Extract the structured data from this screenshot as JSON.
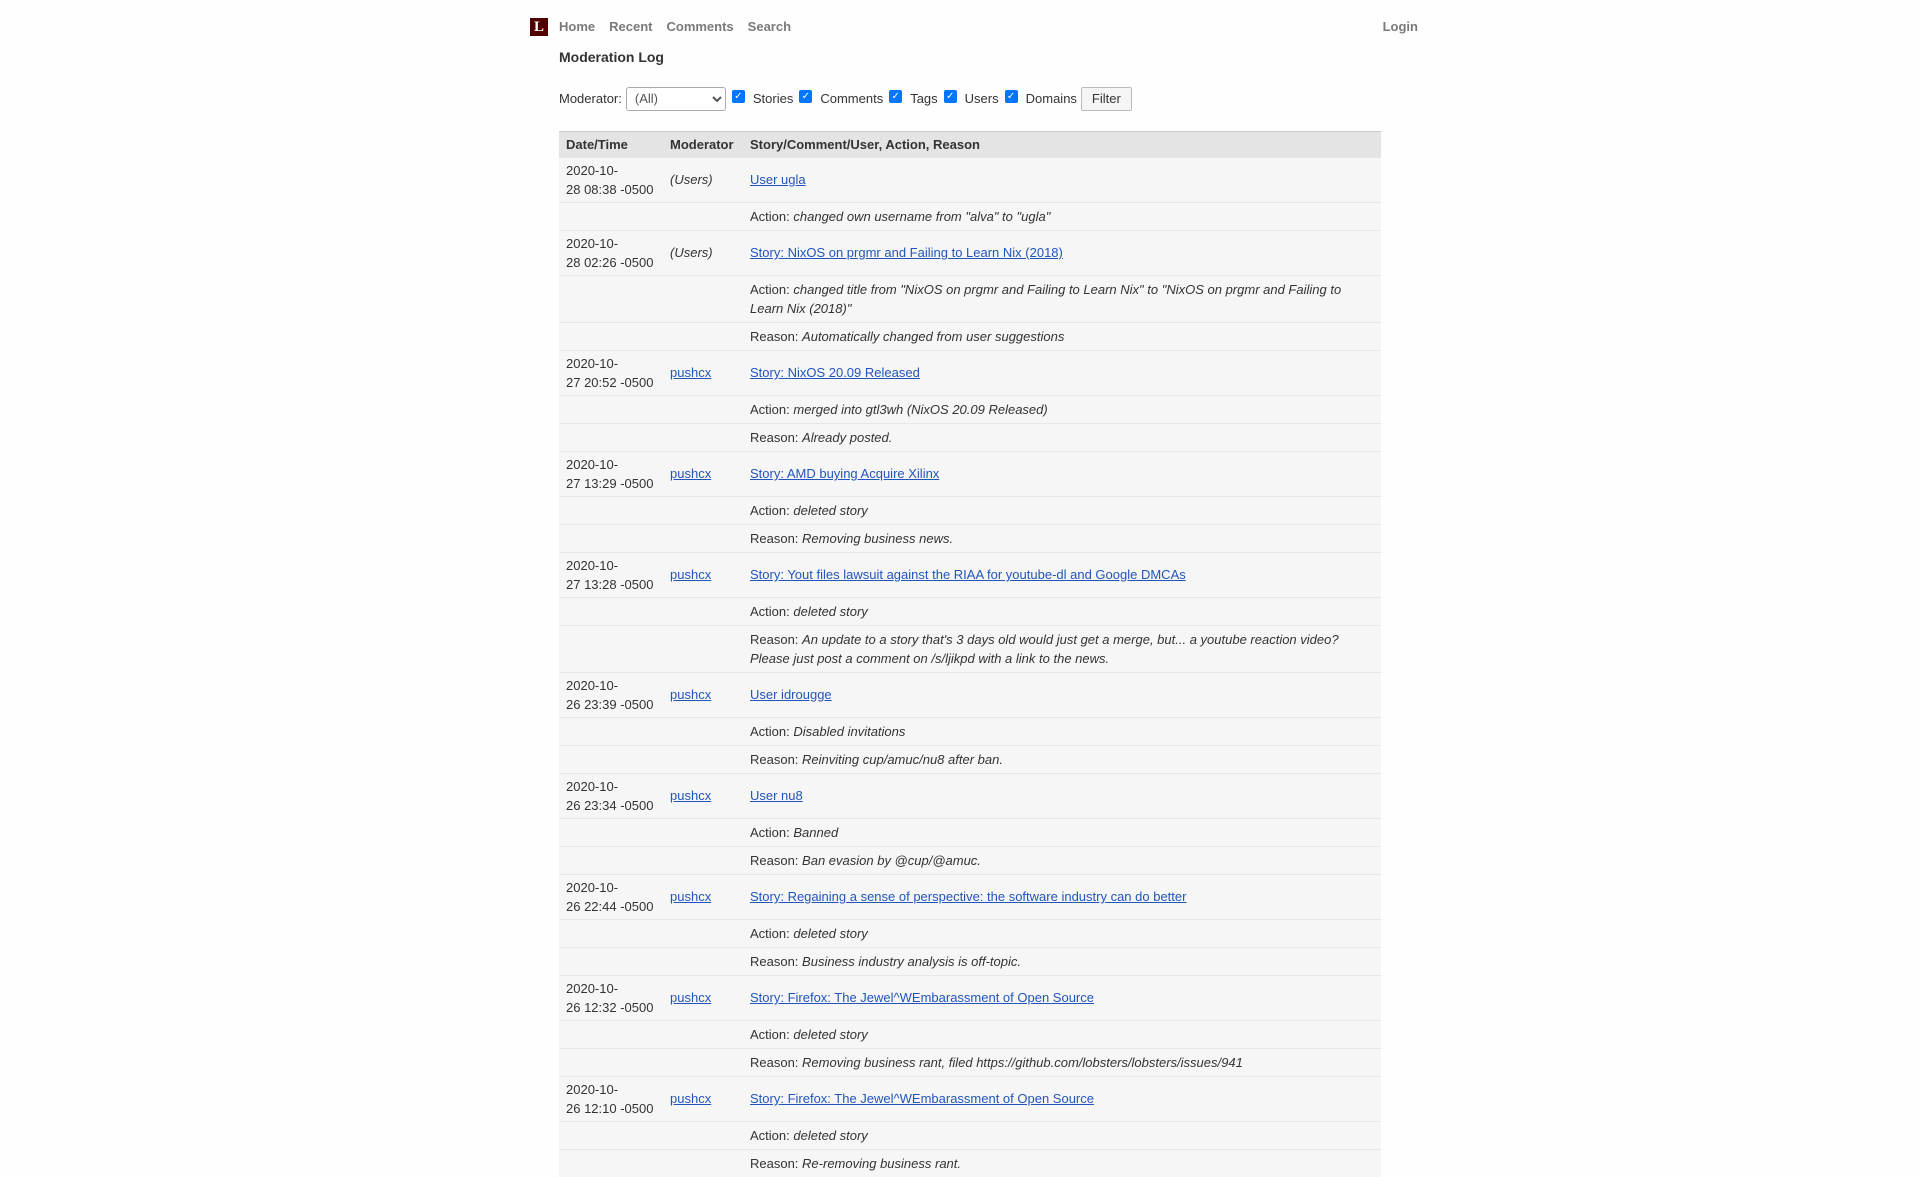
{
  "header": {
    "logo": "L",
    "nav": [
      "Home",
      "Recent",
      "Comments",
      "Search"
    ],
    "login": "Login"
  },
  "page_title": "Moderation Log",
  "filter": {
    "moderator_label": "Moderator:",
    "moderator_selected": "(All)",
    "checkboxes": [
      "Stories",
      "Comments",
      "Tags",
      "Users",
      "Domains"
    ],
    "button": "Filter"
  },
  "table": {
    "headers": [
      "Date/Time",
      "Moderator",
      "Story/Comment/User, Action, Reason"
    ],
    "action_prefix": "Action:",
    "reason_prefix": "Reason:",
    "entries": [
      {
        "date_line1": "2020-10-",
        "date_line2": "28 08:38 -0500",
        "moderator": "(Users)",
        "mod_is_link": false,
        "subject": "User ugla",
        "action": "changed own username from \"alva\" to \"ugla\"",
        "reason": null
      },
      {
        "date_line1": "2020-10-",
        "date_line2": "28 02:26 -0500",
        "moderator": "(Users)",
        "mod_is_link": false,
        "subject": "Story: NixOS on prgmr and Failing to Learn Nix (2018)",
        "action": "changed title from \"NixOS on prgmr and Failing to Learn Nix\" to \"NixOS on prgmr and Failing to Learn Nix (2018)\"",
        "reason": "Automatically changed from user suggestions"
      },
      {
        "date_line1": "2020-10-",
        "date_line2": "27 20:52 -0500",
        "moderator": "pushcx",
        "mod_is_link": true,
        "subject": "Story: NixOS 20.09 Released",
        "action": "merged into gtl3wh (NixOS 20.09 Released)",
        "reason": "Already posted."
      },
      {
        "date_line1": "2020-10-",
        "date_line2": "27 13:29 -0500",
        "moderator": "pushcx",
        "mod_is_link": true,
        "subject": "Story: AMD buying Acquire Xilinx",
        "action": "deleted story",
        "reason": "Removing business news."
      },
      {
        "date_line1": "2020-10-",
        "date_line2": "27 13:28 -0500",
        "moderator": "pushcx",
        "mod_is_link": true,
        "subject": "Story: Yout files lawsuit against the RIAA for youtube-dl and Google DMCAs",
        "action": "deleted story",
        "reason": "An update to a story that's 3 days old would just get a merge, but... a youtube reaction video? Please just post a comment on /s/ljikpd with a link to the news."
      },
      {
        "date_line1": "2020-10-",
        "date_line2": "26 23:39 -0500",
        "moderator": "pushcx",
        "mod_is_link": true,
        "subject": "User idrougge",
        "action": "Disabled invitations",
        "reason": "Reinviting cup/amuc/nu8 after ban."
      },
      {
        "date_line1": "2020-10-",
        "date_line2": "26 23:34 -0500",
        "moderator": "pushcx",
        "mod_is_link": true,
        "subject": "User nu8",
        "action": "Banned",
        "reason": "Ban evasion by @cup/@amuc."
      },
      {
        "date_line1": "2020-10-",
        "date_line2": "26 22:44 -0500",
        "moderator": "pushcx",
        "mod_is_link": true,
        "subject": "Story: Regaining a sense of perspective: the software industry can do better",
        "action": "deleted story",
        "reason": "Business industry analysis is off-topic."
      },
      {
        "date_line1": "2020-10-",
        "date_line2": "26 12:32 -0500",
        "moderator": "pushcx",
        "mod_is_link": true,
        "subject": "Story: Firefox: The Jewel^WEmbarassment of Open Source",
        "action": "deleted story",
        "reason": "Removing business rant, filed https://github.com/lobsters/lobsters/issues/941"
      },
      {
        "date_line1": "2020-10-",
        "date_line2": "26 12:10 -0500",
        "moderator": "pushcx",
        "mod_is_link": true,
        "subject": "Story: Firefox: The Jewel^WEmbarassment of Open Source",
        "action": "deleted story",
        "reason": "Re-removing business rant."
      }
    ]
  }
}
